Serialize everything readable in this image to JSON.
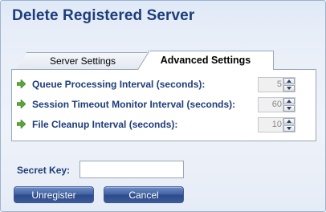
{
  "dialog": {
    "title": "Delete Registered Server"
  },
  "tabs": [
    {
      "label": "Server Settings",
      "active": false
    },
    {
      "label": "Advanced Settings",
      "active": true
    }
  ],
  "settings": [
    {
      "label": "Queue Processing Interval (seconds):",
      "value": "5"
    },
    {
      "label": "Session Timeout Monitor Interval (seconds):",
      "value": "60"
    },
    {
      "label": "File Cleanup Interval (seconds):",
      "value": "10"
    }
  ],
  "secret_key": {
    "label": "Secret Key:",
    "value": ""
  },
  "buttons": {
    "unregister": "Unregister",
    "cancel": "Cancel"
  },
  "colors": {
    "title": "#1d3d7a",
    "button": "#3e5f9f",
    "arrow": "#5aa53a"
  },
  "icons": {
    "row_arrow": "green-right-arrow-icon"
  }
}
